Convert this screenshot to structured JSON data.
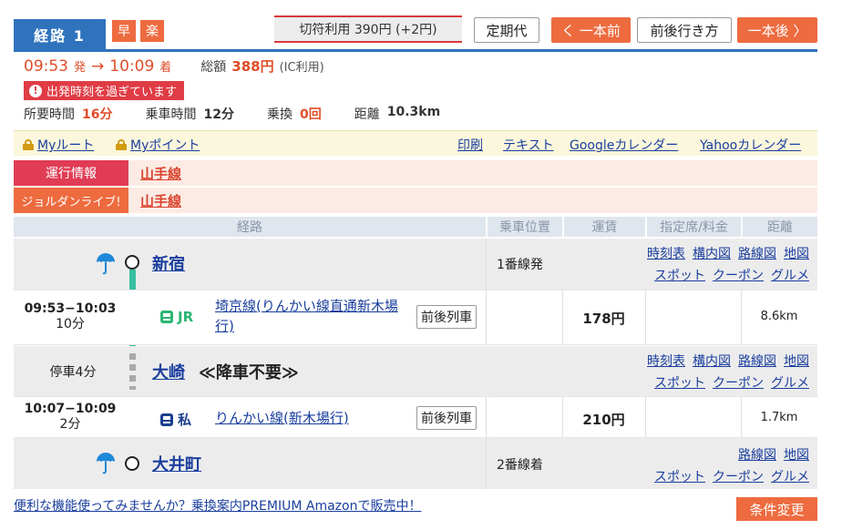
{
  "header": {
    "route_label": "経路 1",
    "badge_fast": "早",
    "badge_easy": "楽",
    "ticket_info": "切符利用  390円 (+2円)",
    "commuter_pass": "定期代",
    "prev_train": "く 一本前",
    "around": "前後行き方",
    "next_train": "一本後 〉"
  },
  "summary": {
    "dep_time": "09:53",
    "dep_suffix": "発",
    "arrow": "→",
    "arr_time": "10:09",
    "arr_suffix": "着",
    "total_label": "総額",
    "fare": "388円",
    "fare_note": "(IC利用)",
    "warning": "出発時刻を過ぎています",
    "required_label": "所要時間",
    "required_value": "16分",
    "ride_label": "乗車時間",
    "ride_value": "12分",
    "transfer_label": "乗換",
    "transfer_value": "0回",
    "distance_label": "距離",
    "distance_value": "10.3km"
  },
  "linkbar": {
    "my_route": "Myルート",
    "my_points": "Myポイント",
    "print": "印刷",
    "text": "テキスト",
    "google_cal": "Googleカレンダー",
    "yahoo_cal": "Yahooカレンダー"
  },
  "info": {
    "operation_label": "運行情報",
    "operation_line": "山手線",
    "jorudan_label": "ジョルダンライブ!",
    "jorudan_line": "山手線"
  },
  "table_headers": [
    "経路",
    "乗車位置",
    "運賃",
    "指定席/料金",
    "距離"
  ],
  "stations": {
    "shinjuku": {
      "name": "新宿",
      "platform": "1番線発",
      "links_row1": [
        "時刻表",
        "構内図",
        "路線図",
        "地図"
      ],
      "links_row2": [
        "スポット",
        "クーポン",
        "グルメ"
      ]
    },
    "osaki": {
      "stop_time": "停車4分",
      "name": "大崎",
      "note": "≪降車不要≫",
      "links_row1": [
        "時刻表",
        "構内図",
        "路線図",
        "地図"
      ],
      "links_row2": [
        "スポット",
        "クーポン",
        "グルメ"
      ]
    },
    "oimachi": {
      "name": "大井町",
      "platform": "2番線着",
      "links_row1": [
        "路線図",
        "地図"
      ],
      "links_row2": [
        "スポット",
        "クーポン",
        "グルメ"
      ]
    }
  },
  "segments": {
    "seg1": {
      "time": "09:53−10:03",
      "duration": "10分",
      "operator": "JR",
      "line": "埼京線(りんかい線直通新木場行)",
      "around_button": "前後列車",
      "fare": "178円",
      "distance": "8.6km"
    },
    "seg2": {
      "time": "10:07−10:09",
      "duration": "2分",
      "operator": "私",
      "line": "りんかい線(新木場行)",
      "around_button": "前後列車",
      "fare": "210円",
      "distance": "1.7km"
    }
  },
  "footer": {
    "promo": "便利な機能使ってみませんか？乗換案内PREMIUM Amazonで販売中！",
    "change_conditions": "条件変更"
  },
  "colors": {
    "accent_blue": "#2f73bd",
    "accent_orange": "#ed6b3f",
    "warn_red": "#e03c45",
    "jr_green": "#2bb673",
    "private_navy": "#1d3f8f",
    "line_teal": "#39c0a0"
  },
  "icons": {
    "umbrella": "umbrella-icon",
    "lock": "lock-icon",
    "train": "train-icon",
    "warning": "exclamation-icon"
  }
}
